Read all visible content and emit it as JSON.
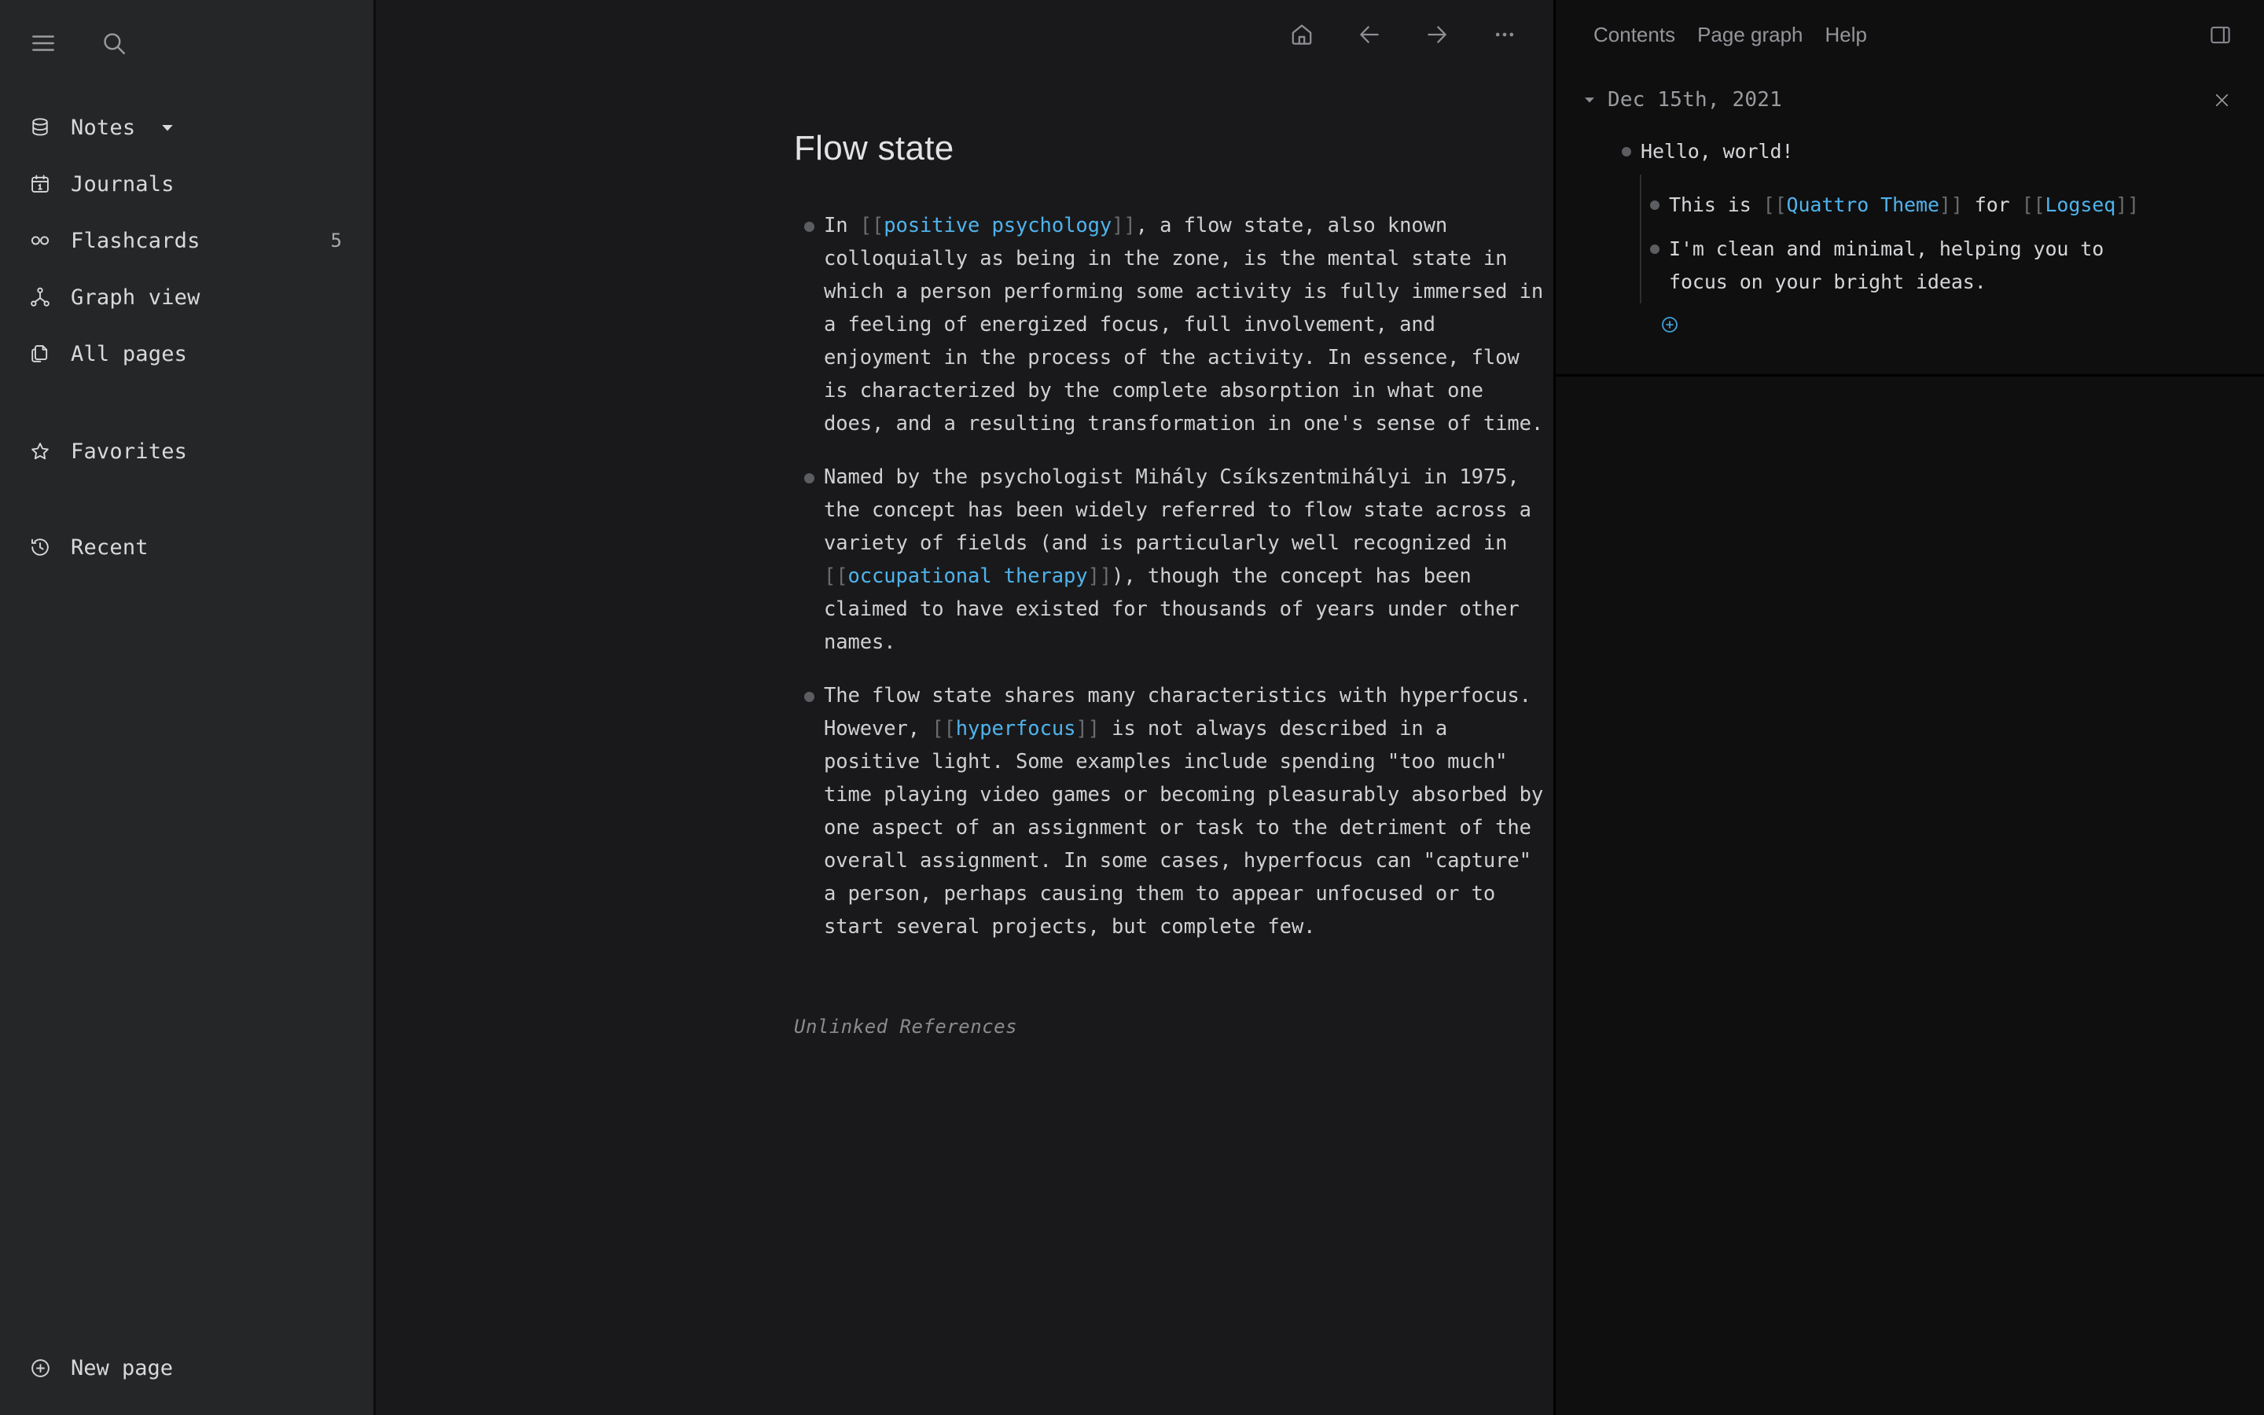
{
  "left_sidebar": {
    "menu_icon": "hamburger-icon",
    "search_icon": "search-icon",
    "graph_switcher": {
      "label": "Notes",
      "icon": "database-icon",
      "caret": "chevron-down-icon"
    },
    "items": [
      {
        "label": "Journals",
        "icon": "calendar-icon",
        "badge": ""
      },
      {
        "label": "Flashcards",
        "icon": "infinity-icon",
        "badge": "5"
      },
      {
        "label": "Graph view",
        "icon": "graph-icon",
        "badge": ""
      },
      {
        "label": "All pages",
        "icon": "pages-icon",
        "badge": ""
      }
    ],
    "favorites": {
      "label": "Favorites",
      "icon": "star-icon"
    },
    "recent": {
      "label": "Recent",
      "icon": "history-icon"
    },
    "new_page": {
      "label": "New page",
      "icon": "plus-circle-icon"
    }
  },
  "main_toolbar": {
    "home_icon": "home-icon",
    "back_icon": "arrow-left-icon",
    "forward_icon": "arrow-right-icon",
    "more_icon": "dots-horizontal-icon"
  },
  "page": {
    "title": "Flow state",
    "unlinked_references_label": "Unlinked References",
    "blocks": [
      {
        "segments": [
          {
            "type": "text",
            "value": "In "
          },
          {
            "type": "bracket",
            "value": "[["
          },
          {
            "type": "ref",
            "value": "positive psychology"
          },
          {
            "type": "bracket",
            "value": "]]"
          },
          {
            "type": "text",
            "value": ", a flow state, also known colloquially as being in the zone, is the mental state in which a person performing some activity is fully immersed in a feeling of energized focus, full involvement, and enjoyment in the process of the activity. In essence, flow is characterized by the complete absorption in what one does, and a resulting transformation in one's sense of time."
          }
        ]
      },
      {
        "segments": [
          {
            "type": "text",
            "value": "Named by the psychologist Mihály Csíkszentmihályi in 1975, the concept has been widely referred to flow state across a variety of fields (and is particularly well recognized in "
          },
          {
            "type": "bracket",
            "value": "[["
          },
          {
            "type": "ref",
            "value": "occupational therapy"
          },
          {
            "type": "bracket",
            "value": "]]"
          },
          {
            "type": "text",
            "value": "), though the concept has been claimed to have existed for thousands of years under other names."
          }
        ]
      },
      {
        "segments": [
          {
            "type": "text",
            "value": "The flow state shares many characteristics with hyperfocus. However, "
          },
          {
            "type": "bracket",
            "value": "[["
          },
          {
            "type": "ref",
            "value": "hyperfocus"
          },
          {
            "type": "bracket",
            "value": "]]"
          },
          {
            "type": "text",
            "value": " is not always described in a positive light. Some examples include spending \"too much\" time playing video games or becoming pleasurably absorbed by one aspect of an assignment or task to the detriment of the overall assignment. In some cases, hyperfocus can \"capture\" a person, perhaps causing them to appear unfocused or to start several projects, but complete few."
          }
        ]
      }
    ]
  },
  "right_panel": {
    "tabs": [
      {
        "label": "Contents"
      },
      {
        "label": "Page graph"
      },
      {
        "label": "Help"
      }
    ],
    "toggle_icon": "right-sidebar-toggle-icon",
    "item": {
      "caret_icon": "caret-down-icon",
      "date": "Dec 15th, 2021",
      "close_icon": "close-icon",
      "add_icon": "plus-circle-icon",
      "root": {
        "segments": [
          {
            "type": "text",
            "value": "Hello, world!"
          }
        ]
      },
      "children": [
        {
          "segments": [
            {
              "type": "text",
              "value": "This is "
            },
            {
              "type": "bracket",
              "value": "[["
            },
            {
              "type": "ref",
              "value": "Quattro Theme"
            },
            {
              "type": "bracket",
              "value": "]]"
            },
            {
              "type": "text",
              "value": " for "
            },
            {
              "type": "bracket",
              "value": "[["
            },
            {
              "type": "ref",
              "value": "Logseq"
            },
            {
              "type": "bracket",
              "value": "]]"
            }
          ]
        },
        {
          "segments": [
            {
              "type": "text",
              "value": "I'm clean and minimal, helping you to focus on your bright ideas."
            }
          ]
        }
      ]
    }
  },
  "colors": {
    "sidebar_bg": "#252628",
    "main_bg": "#19191b",
    "right_panel_bg": "#0f0f10",
    "link_blue": "#4fb3ec",
    "bracket_gray": "#6a6b6e",
    "text_primary": "#cfd0d2",
    "bullet": "#5c5d60"
  }
}
